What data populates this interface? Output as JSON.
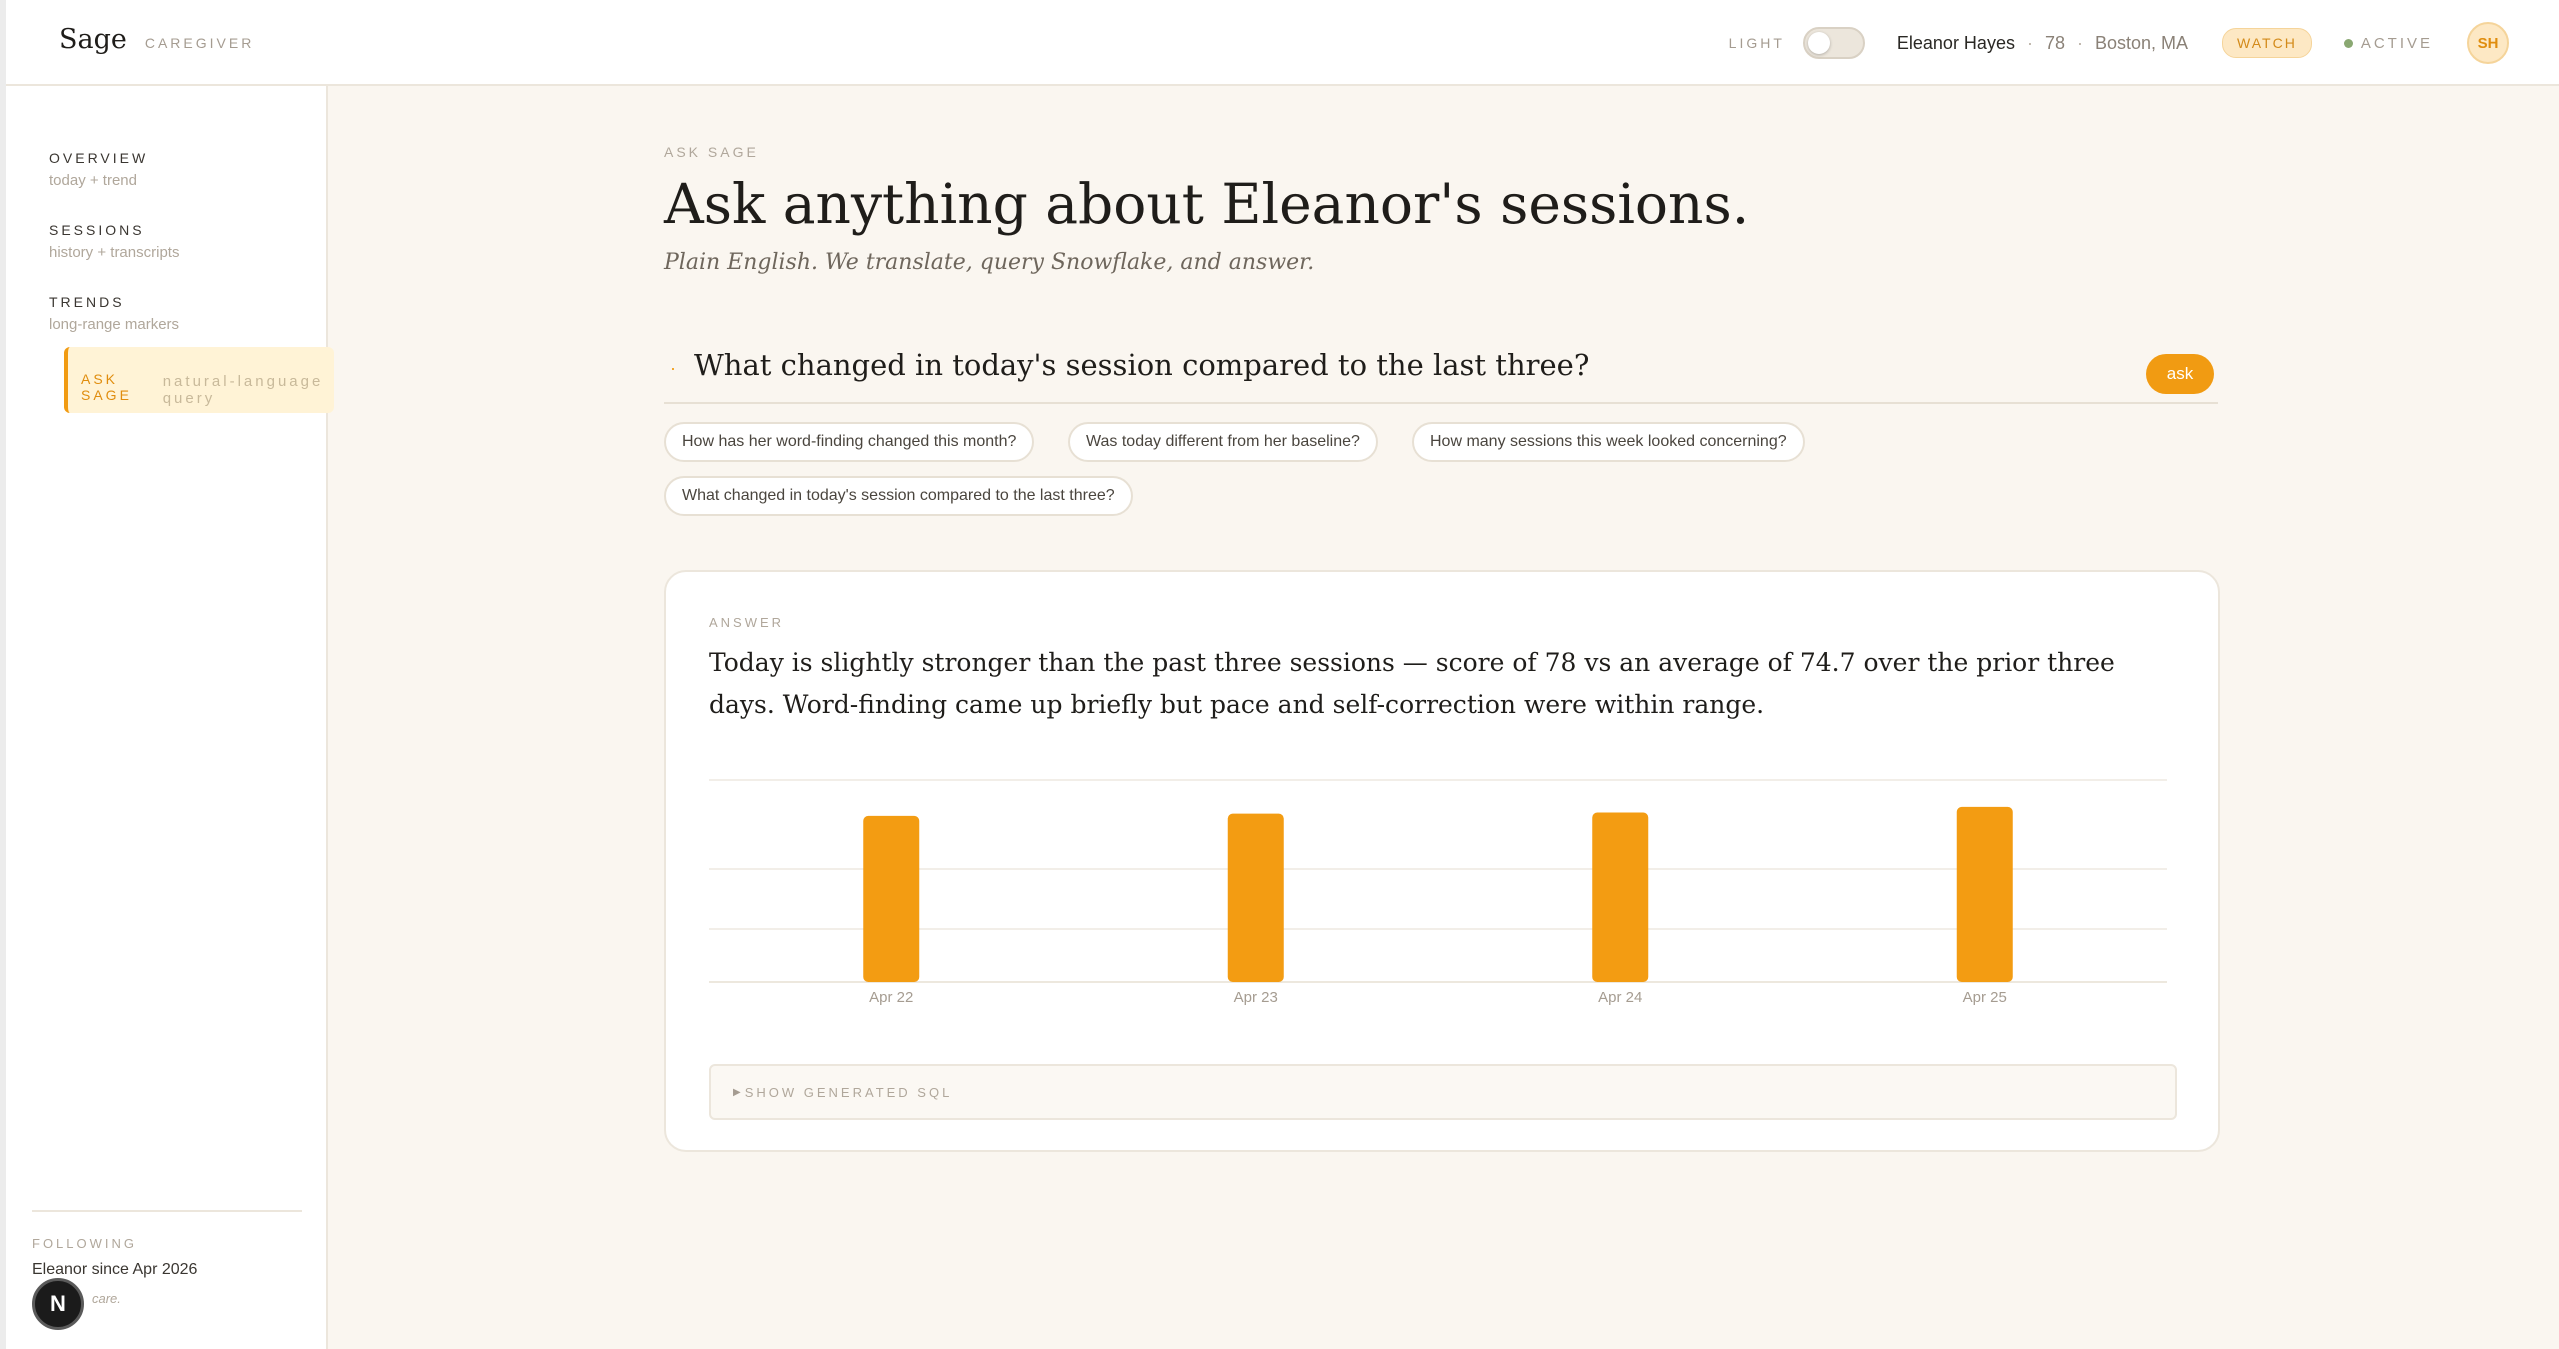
{
  "header": {
    "brand": "Sage",
    "brand_sub": "CAREGIVER",
    "light_label": "LIGHT",
    "patient_name": "Eleanor Hayes",
    "patient_age": "78",
    "patient_location": "Boston, MA",
    "watch_badge": "WATCH",
    "status": "ACTIVE",
    "avatar_initials": "SH",
    "separator": "·"
  },
  "sidebar": {
    "items": [
      {
        "title": "OVERVIEW",
        "sub": "today + trend"
      },
      {
        "title": "SESSIONS",
        "sub": "history + transcripts"
      },
      {
        "title": "TRENDS",
        "sub": "long-range markers"
      },
      {
        "title": "ASK SAGE",
        "sub": "natural-language query"
      }
    ],
    "following_label": "FOLLOWING",
    "following_text": "Eleanor since Apr 2026",
    "following_note": "care.",
    "badge": "N"
  },
  "main": {
    "eyebrow": "ASK SAGE",
    "title": "Ask anything about Eleanor's sessions.",
    "subtitle": "Plain English. We translate, query Snowflake, and answer.",
    "query_bullet": "·",
    "query": "What changed in today's session compared to the last three?",
    "ask_label": "ask",
    "suggestions": [
      "How has her word-finding changed this month?",
      "Was today different from her baseline?",
      "How many sessions this week looked concerning?",
      "What changed in today's session compared to the last three?"
    ]
  },
  "answer_card": {
    "eyebrow": "ANSWER",
    "text": "Today is slightly stronger than the past three sessions — score of 78 vs an average of 74.7 over the prior three days. Word-finding came up briefly but pace and self-correction were within range.",
    "sql_toggle": "SHOW GENERATED SQL",
    "sql_triangle": "▶"
  },
  "chart_data": {
    "type": "bar",
    "categories": [
      "Apr 22",
      "Apr 23",
      "Apr 24",
      "Apr 25"
    ],
    "values": [
      74,
      75,
      75.5,
      78
    ],
    "ylim": [
      0,
      90
    ],
    "grid": true,
    "bar_color": "#f39c12"
  },
  "colors": {
    "accent": "#f19b12",
    "background": "#faf6f0",
    "watch_bg": "#fde8c4"
  }
}
